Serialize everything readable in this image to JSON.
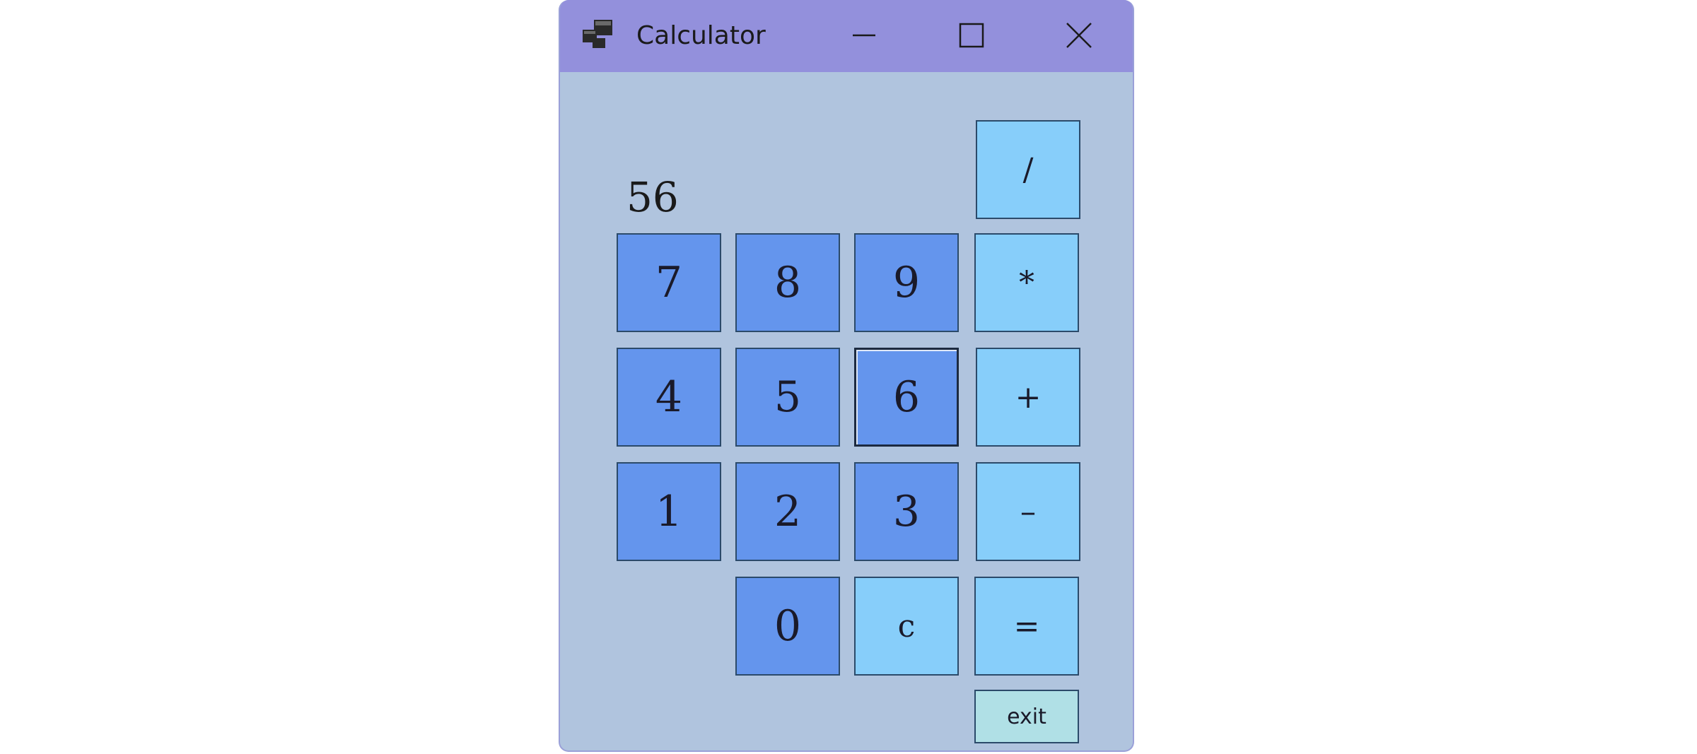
{
  "window": {
    "title": "Calculator",
    "icon": "app-window-icon",
    "controls": {
      "minimize_icon": "minimize-icon",
      "maximize_icon": "maximize-icon",
      "close_icon": "close-icon"
    }
  },
  "display": {
    "value": "56"
  },
  "keys": {
    "divide": "/",
    "multiply": "*",
    "plus": "+",
    "minus": "–",
    "equals": "=",
    "clear": "c",
    "exit": "exit",
    "seven": "7",
    "eight": "8",
    "nine": "9",
    "four": "4",
    "five": "5",
    "six": "6",
    "one": "1",
    "two": "2",
    "three": "3",
    "zero": "0"
  },
  "colors": {
    "window_bg": "#b0c4de",
    "titlebar_bg": "#9390dc",
    "number_key_bg": "#6495ed",
    "operator_key_bg": "#87cefa",
    "exit_key_bg": "#b0e0e6"
  }
}
